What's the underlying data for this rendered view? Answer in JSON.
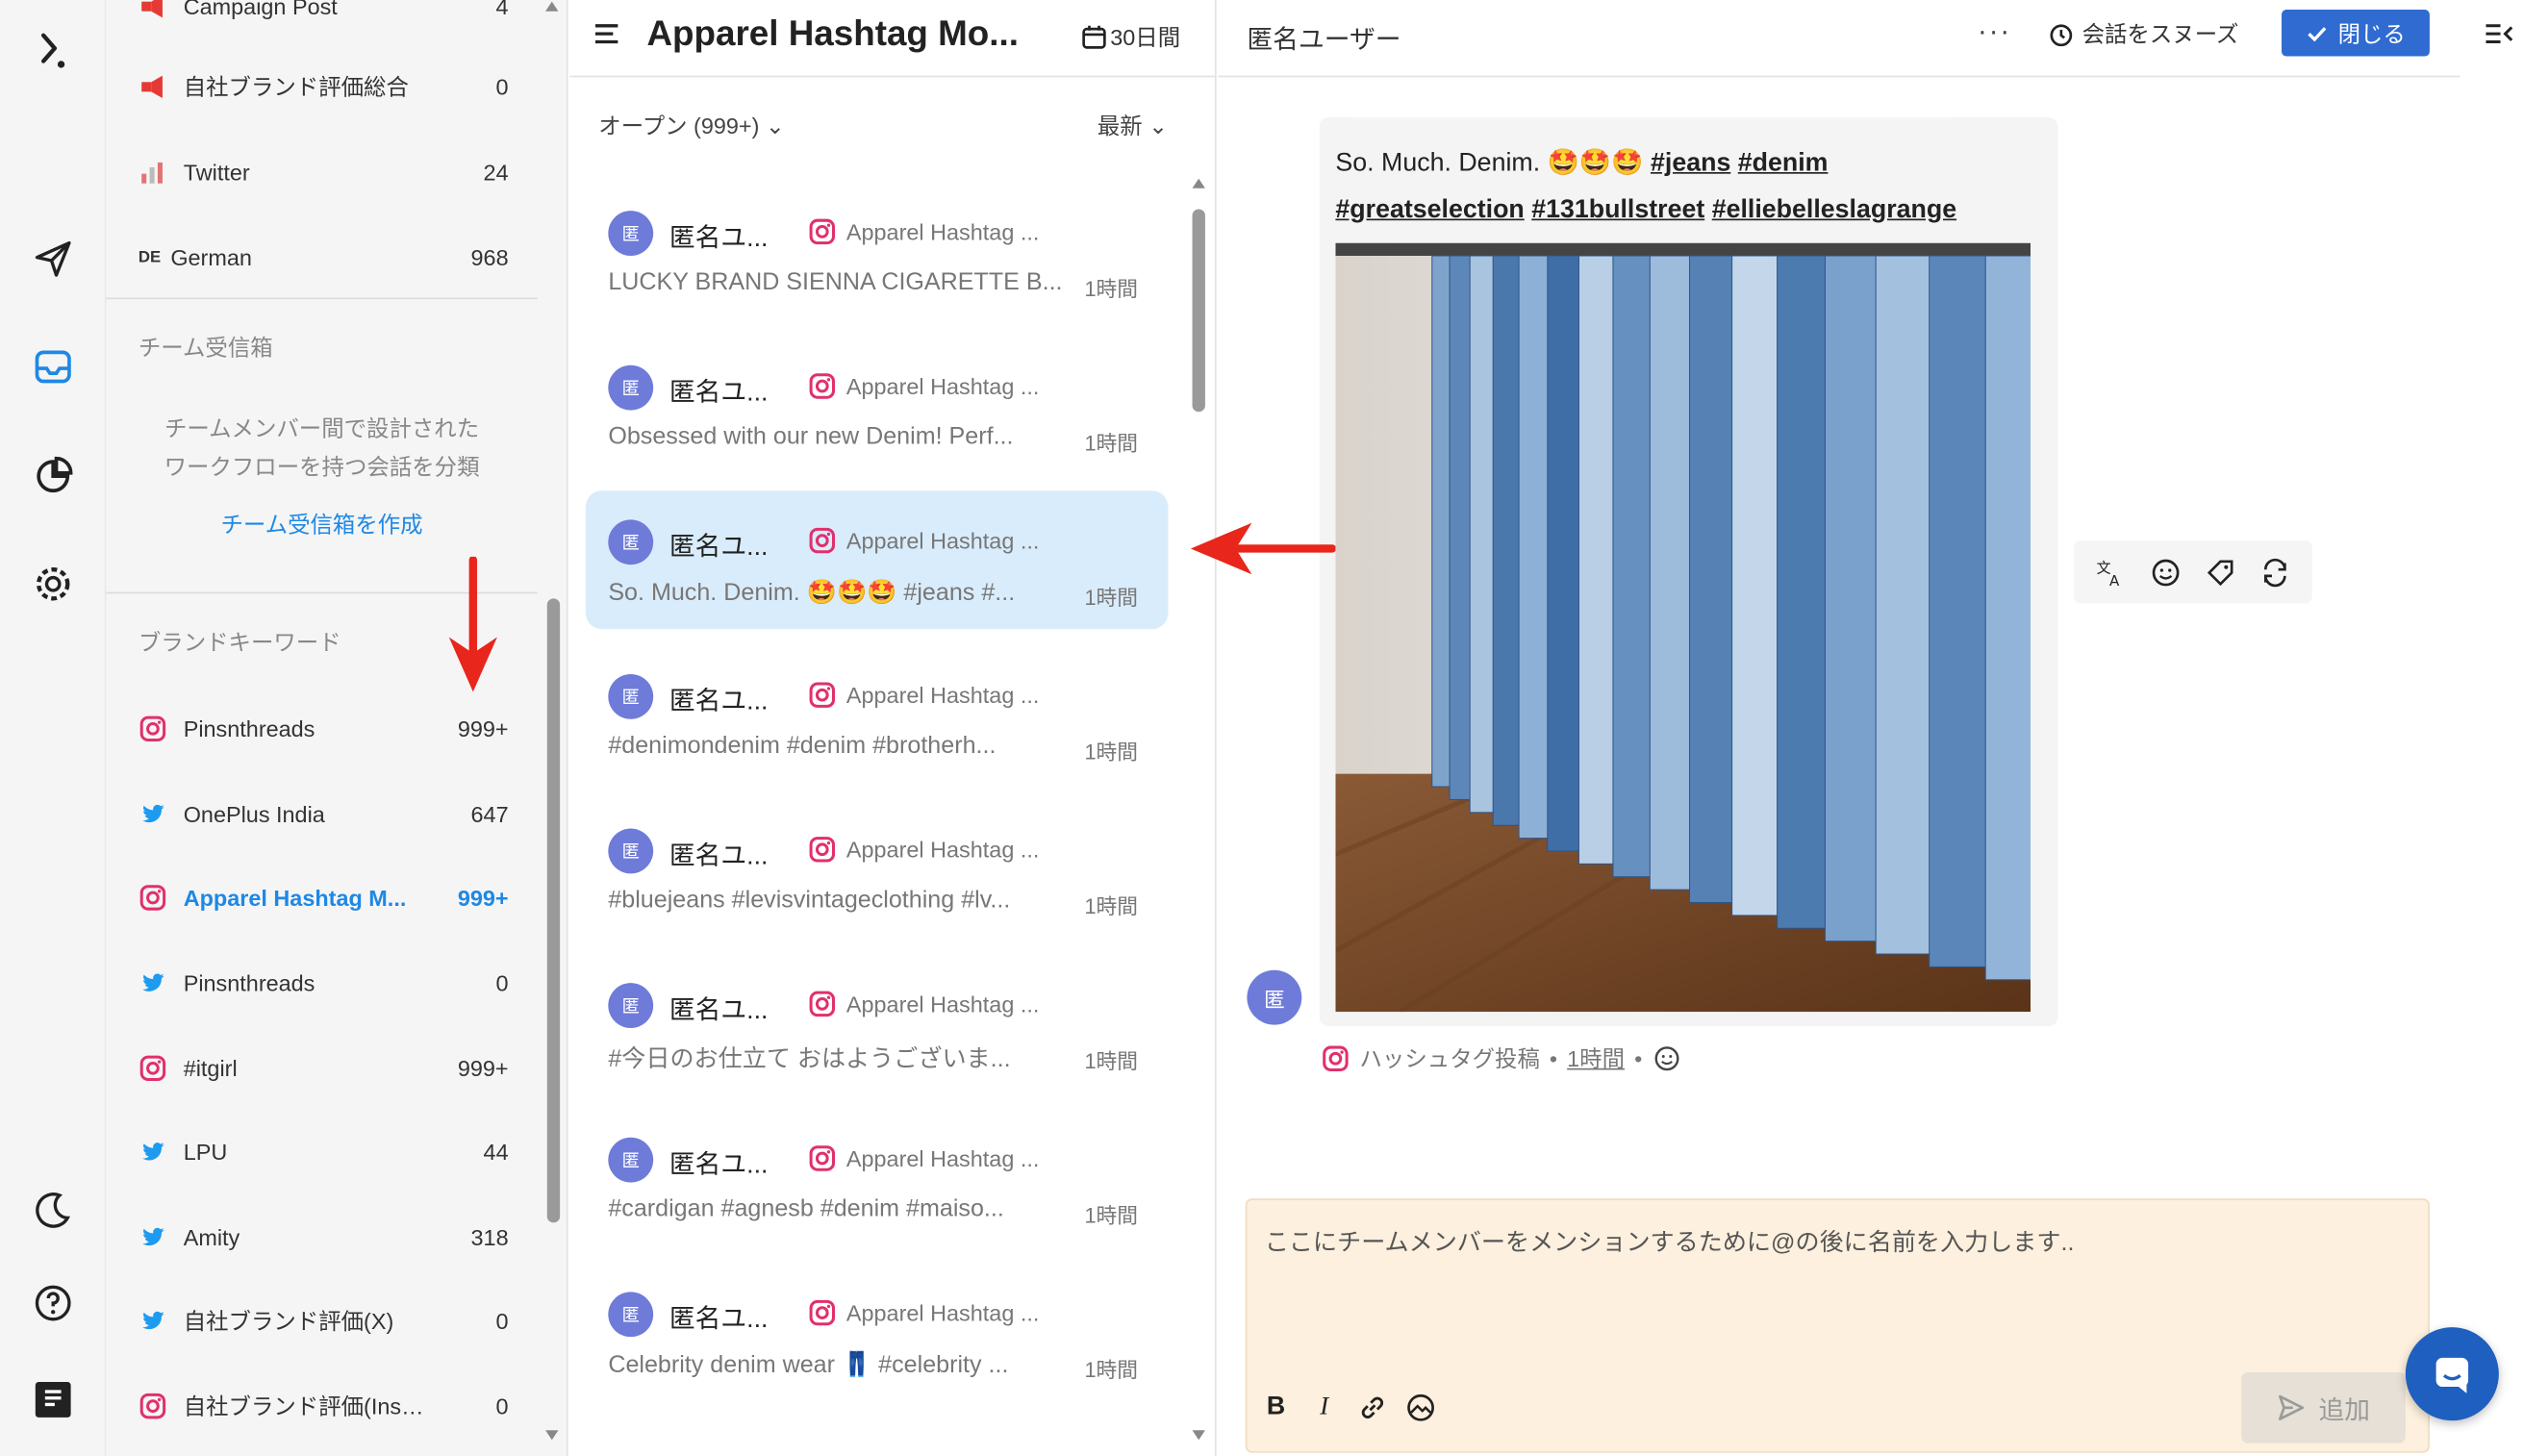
{
  "rail": {
    "icons": [
      "logo-icon",
      "send-icon",
      "inbox-icon",
      "reports-icon",
      "settings-icon",
      "dark-mode-icon",
      "help-icon",
      "news-icon"
    ]
  },
  "sidebar": {
    "top_items": [
      {
        "label": "Campaign Post",
        "count": "4"
      },
      {
        "label": "自社ブランド評価総合",
        "count": "0"
      },
      {
        "label": "Twitter",
        "count": "24"
      },
      {
        "label": "German",
        "count": "968",
        "prefix": "DE"
      }
    ],
    "team_inbox": {
      "title": "チーム受信箱",
      "desc_line1": "チームメンバー間で設計された",
      "desc_line2": "ワークフローを持つ会話を分類",
      "create_link": "チーム受信箱を作成"
    },
    "brand_keywords_title": "ブランドキーワード",
    "brand_items": [
      {
        "label": "Pinsnthreads",
        "count": "999+",
        "icon": "instagram-icon"
      },
      {
        "label": "OnePlus India",
        "count": "647",
        "icon": "twitter-icon"
      },
      {
        "label": "Apparel Hashtag M...",
        "count": "999+",
        "icon": "instagram-icon"
      },
      {
        "label": "Pinsnthreads",
        "count": "0",
        "icon": "twitter-icon"
      },
      {
        "label": "#itgirl",
        "count": "999+",
        "icon": "instagram-icon"
      },
      {
        "label": "LPU",
        "count": "44",
        "icon": "twitter-icon"
      },
      {
        "label": "Amity",
        "count": "318",
        "icon": "twitter-icon"
      },
      {
        "label": "自社ブランド評価(X)",
        "count": "0",
        "icon": "twitter-icon"
      },
      {
        "label": "自社ブランド評価(Instagr...",
        "count": "0",
        "icon": "instagram-icon"
      }
    ]
  },
  "list": {
    "title": "Apparel Hashtag Mo...",
    "range": "30日間",
    "filter": "オープン (999+)",
    "sort": "最新",
    "conversations": [
      {
        "avatar": "匿",
        "name": "匿名ユ...",
        "source": "Apparel Hashtag ...",
        "snippet": "LUCKY BRAND SIENNA CIGARETTE B...",
        "time": "1時間"
      },
      {
        "avatar": "匿",
        "name": "匿名ユ...",
        "source": "Apparel Hashtag ...",
        "snippet": "Obsessed with our new Denim! Perf...",
        "time": "1時間"
      },
      {
        "avatar": "匿",
        "name": "匿名ユ...",
        "source": "Apparel Hashtag ...",
        "snippet": "So. Much. Denim. 🤩🤩🤩 #jeans #...",
        "time": "1時間"
      },
      {
        "avatar": "匿",
        "name": "匿名ユ...",
        "source": "Apparel Hashtag ...",
        "snippet": "#denimondenim #denim #brotherh...",
        "time": "1時間"
      },
      {
        "avatar": "匿",
        "name": "匿名ユ...",
        "source": "Apparel Hashtag ...",
        "snippet": "#bluejeans #levisvintageclothing #lv...",
        "time": "1時間"
      },
      {
        "avatar": "匿",
        "name": "匿名ユ...",
        "source": "Apparel Hashtag ...",
        "snippet": "#今日のお仕立て おはようございま...",
        "time": "1時間"
      },
      {
        "avatar": "匿",
        "name": "匿名ユ...",
        "source": "Apparel Hashtag ...",
        "snippet": "#cardigan #agnesb #denim #maiso...",
        "time": "1時間"
      },
      {
        "avatar": "匿",
        "name": "匿名ユ...",
        "source": "Apparel Hashtag ...",
        "snippet": "Celebrity denim wear 👖 #celebrity ...",
        "time": "1時間"
      }
    ]
  },
  "main": {
    "user": "匿名ユーザー",
    "more": "···",
    "snooze": "会話をスヌーズ",
    "close": "閉じる",
    "post": {
      "text_plain": "So. Much. Denim. 🤩🤩🤩",
      "tags_line1": [
        "#jeans",
        "#denim"
      ],
      "tags_line2": [
        "#greatselection",
        "#131bullstreet",
        "#elliebelleslagrange"
      ]
    },
    "avatar": "匿",
    "meta_type": "ハッシュタグ投稿",
    "meta_time": "1時間",
    "composer_placeholder": "ここにチームメンバーをメンションするために@の後に名前を入力します..",
    "send": "追加"
  },
  "colors": {
    "accent": "#1e88e5",
    "close_button": "#2f6bd1",
    "arrow": "#e8261c",
    "selected_row": "#d9ecfb",
    "composer_bg": "#fdf0de"
  }
}
